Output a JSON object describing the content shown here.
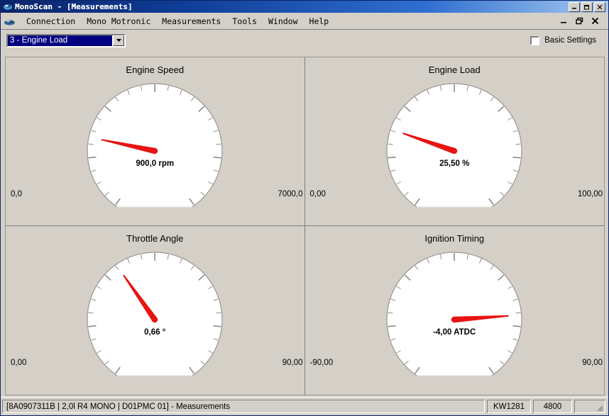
{
  "window": {
    "title": "MonoScan  -  [Measurements]",
    "icon": "app-icon",
    "sys_minimize": "–",
    "sys_restore": "❐",
    "sys_close": "✕"
  },
  "menubar": {
    "icon": "mdi-app-icon",
    "items": [
      {
        "label": "Connection"
      },
      {
        "label": "Mono Motronic"
      },
      {
        "label": "Measurements"
      },
      {
        "label": "Tools"
      },
      {
        "label": "Window"
      },
      {
        "label": "Help"
      }
    ],
    "mdi_minimize": "minimize-icon",
    "mdi_restore": "restore-icon",
    "mdi_close": "close-icon"
  },
  "toolbar": {
    "group_select": {
      "value": "3 - Engine Load",
      "arrow": "chevron-down-icon"
    },
    "basic_settings": {
      "label": "Basic Settings",
      "checked": false
    }
  },
  "gauges": [
    {
      "title": "Engine Speed",
      "value_text": "900,0 rpm",
      "value": 900.0,
      "unit": "rpm",
      "min": 0,
      "max": 7000,
      "min_label": "0,0",
      "max_label": "7000,0",
      "needle_angle_deg": 192.0,
      "needle_color": "#e81313"
    },
    {
      "title": "Engine Load",
      "value_text": "25,50 %",
      "value": 25.5,
      "unit": "%",
      "min": 0,
      "max": 100,
      "min_label": "0,00",
      "max_label": "100,00",
      "needle_angle_deg": 199.0,
      "needle_color": "#e81313"
    },
    {
      "title": "Throttle Angle",
      "value_text": "0,66 °",
      "value": 0.66,
      "unit": "°",
      "min": 0,
      "max": 90,
      "min_label": "0,00",
      "max_label": "90,00",
      "needle_angle_deg": 235.0,
      "needle_color": "#e81313"
    },
    {
      "title": "Ignition Timing",
      "value_text": "-4,00 ATDC",
      "value": -4.0,
      "unit": "ATDC",
      "min": -90,
      "max": 90,
      "min_label": "-90,00",
      "max_label": "90,00",
      "needle_angle_deg": 356.0,
      "needle_color": "#e81313"
    }
  ],
  "statusbar": {
    "main": "[8A0907311B  |  2,0l R4 MONO  |  D01PMC 01] - Measurements",
    "protocol": "KW1281",
    "baud": "4800",
    "extra": "",
    "grip": "resize-grip-icon"
  },
  "colors": {
    "face": "#ffffff",
    "rim": "#9a968e",
    "tick": "#8c8c8c",
    "needle": "#e81313",
    "window_bg": "#d4d0c8",
    "title_start": "#0a246a",
    "title_end": "#a6caf0",
    "select_bg": "#000080"
  }
}
